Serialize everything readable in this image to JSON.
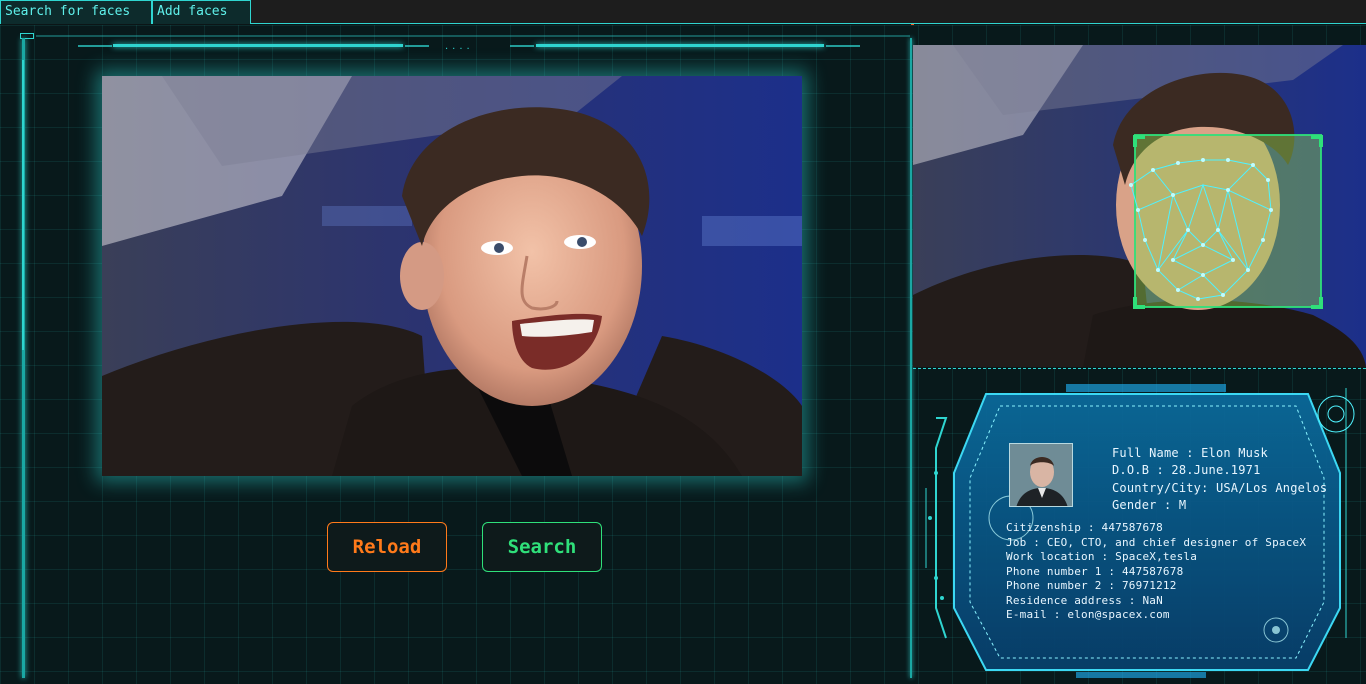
{
  "tabs": [
    {
      "label": "Search for faces"
    },
    {
      "label": "Add faces"
    }
  ],
  "buttons": {
    "reload_label": "Reload",
    "search_label": "Search"
  },
  "profile": {
    "full_name": "Full Name : Elon Musk",
    "dob": "D.O.B : 28.June.1971",
    "country_city": "Country/City: USA/Los Angelos",
    "gender": "Gender : M",
    "citizenship": "Citizenship : 447587678",
    "job": "Job : CEO, CTO, and chief designer of SpaceX",
    "work_location": "Work location : SpaceX,tesla",
    "phone1": "Phone number 1 : 447587678",
    "phone2": "Phone number 2 : 76971212",
    "residence": "Residence address : NaN",
    "email": "E-mail : elon@spacex.com"
  },
  "colors": {
    "accent": "#2fd5d0",
    "reload": "#ff7a1a",
    "search": "#2fe07a",
    "card": "#0d5f8c"
  }
}
